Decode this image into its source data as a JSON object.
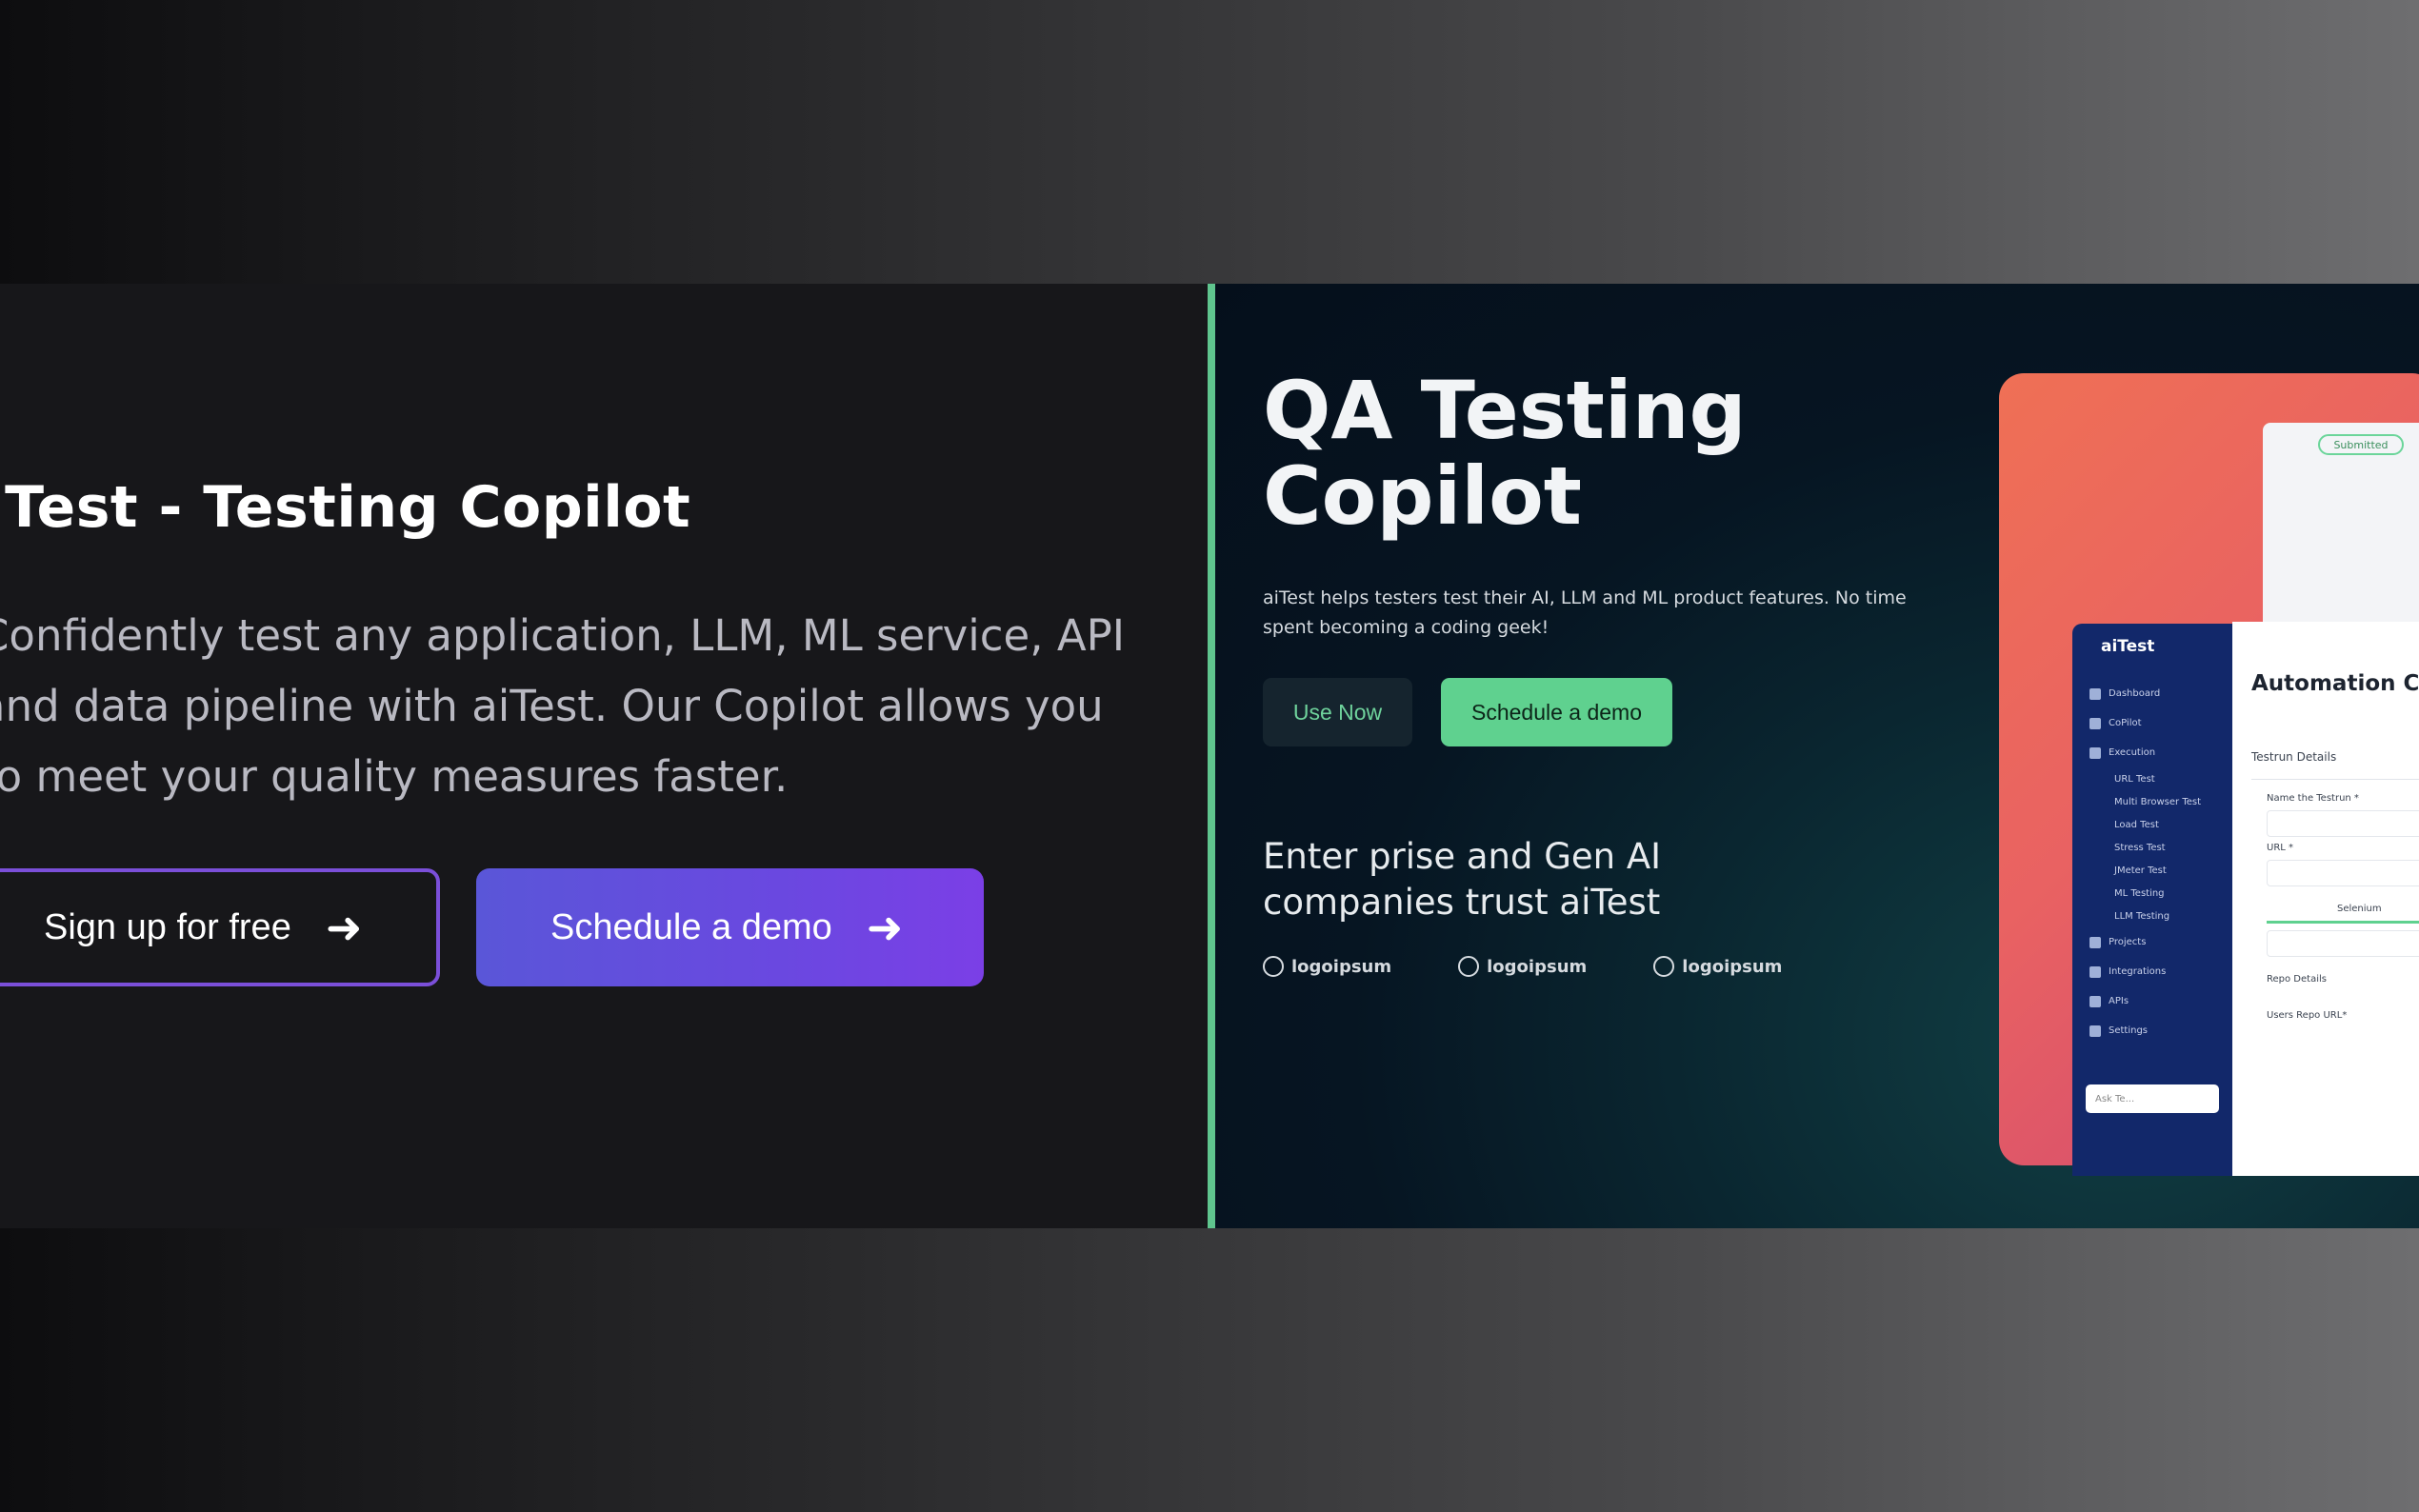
{
  "left": {
    "title": "iTest - Testing Copilot",
    "description": "Confidently test any application, LLM, ML service, API and data pipeline with aiTest. Our Copilot allows you to meet your quality measures faster.",
    "signup_label": "Sign up for free",
    "demo_label": "Schedule a demo"
  },
  "right": {
    "title": "QA Testing Copilot",
    "subtitle": "aiTest helps testers test their AI, LLM and ML product features. No time spent becoming a coding geek!",
    "use_now_label": "Use Now",
    "demo_label": "Schedule a demo",
    "trust_text": "Enter prise and Gen AI companies trust aiTest",
    "logos": [
      "logoipsum",
      "logoipsum",
      "logoipsum"
    ]
  },
  "mockup": {
    "brand": "aiTest",
    "status_chip": "Submitted",
    "nav": [
      "Dashboard",
      "CoPilot",
      "Execution"
    ],
    "sub_nav": [
      "URL Test",
      "Multi Browser Test",
      "Load Test",
      "Stress Test",
      "JMeter Test",
      "ML Testing",
      "LLM Testing"
    ],
    "nav_bottom": [
      "Projects",
      "Integrations",
      "APIs",
      "Settings"
    ],
    "ask_placeholder": "Ask Te...",
    "heading": "Automation Co",
    "section": "Testrun Details",
    "name_label": "Name the Testrun *",
    "url_label": "URL *",
    "tab_label": "Selenium",
    "repo_label": "Repo Details",
    "users_label": "Users Repo URL*"
  },
  "colors": {
    "accent_purple": "#6a48e0",
    "accent_green": "#5fd18f",
    "divider_green": "#5fc58e"
  }
}
